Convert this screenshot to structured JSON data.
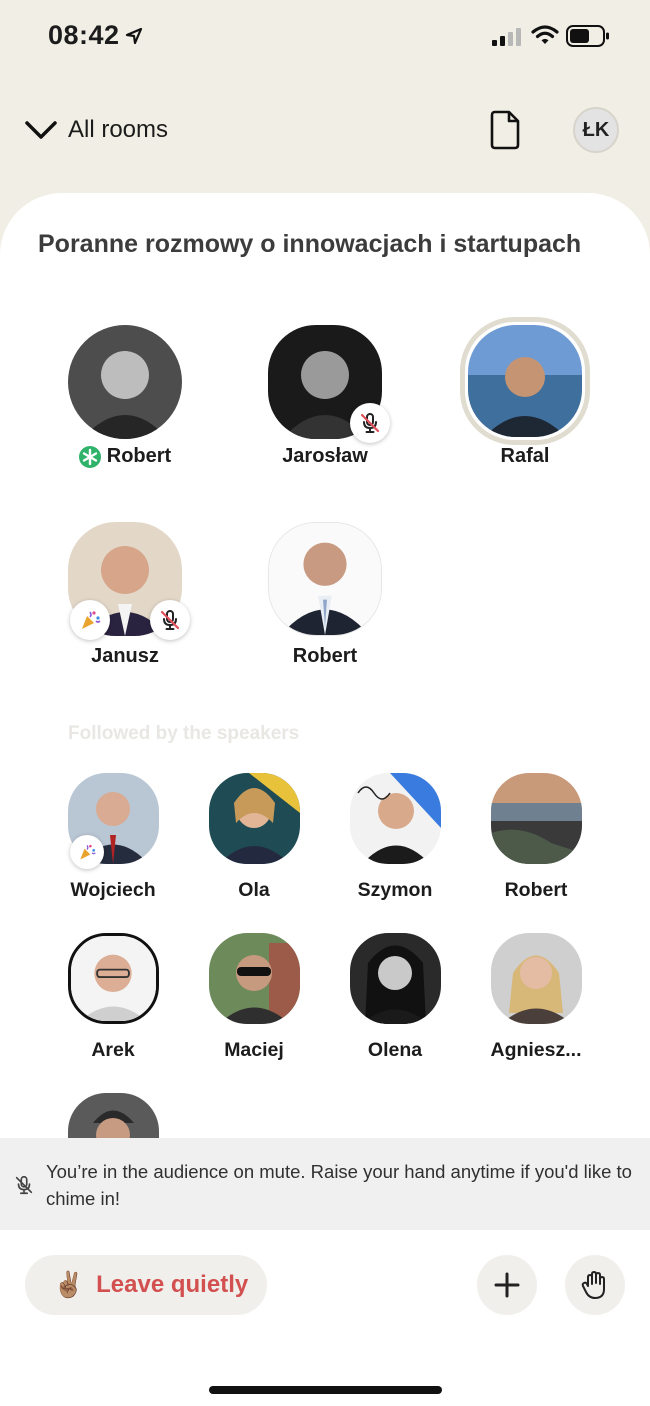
{
  "status_bar": {
    "time": "08:42"
  },
  "nav": {
    "back_label": "All rooms",
    "profile_initials": "ŁK"
  },
  "room": {
    "title": "Poranne rozmowy o innowacjach i startupach",
    "speakers": [
      {
        "name": "Robert",
        "moderator": true,
        "muted": false
      },
      {
        "name": "Jarosław",
        "moderator": false,
        "muted": true
      },
      {
        "name": "Rafal",
        "moderator": false,
        "muted": false,
        "speaking": true
      },
      {
        "name": "Janusz",
        "moderator": false,
        "muted": true,
        "new_member": true
      },
      {
        "name": "Robert",
        "moderator": false,
        "muted": false
      }
    ],
    "followed_label": "Followed by the speakers",
    "followed": [
      {
        "name": "Wojciech",
        "new_member": true
      },
      {
        "name": "Ola"
      },
      {
        "name": "Szymon"
      },
      {
        "name": "Robert"
      },
      {
        "name": "Arek"
      },
      {
        "name": "Maciej"
      },
      {
        "name": "Olena"
      },
      {
        "name": "Agniesz..."
      },
      {
        "name": ""
      }
    ]
  },
  "mute_banner": {
    "text": "You’re in the audience on mute. Raise your hand anytime if you'd like to chime in!"
  },
  "actions": {
    "leave_emoji": "✌🏽",
    "leave_label": "Leave quietly"
  },
  "colors": {
    "leave_text": "#d35050",
    "moderator_green": "#2fb36b",
    "background": "#f1efe5"
  }
}
